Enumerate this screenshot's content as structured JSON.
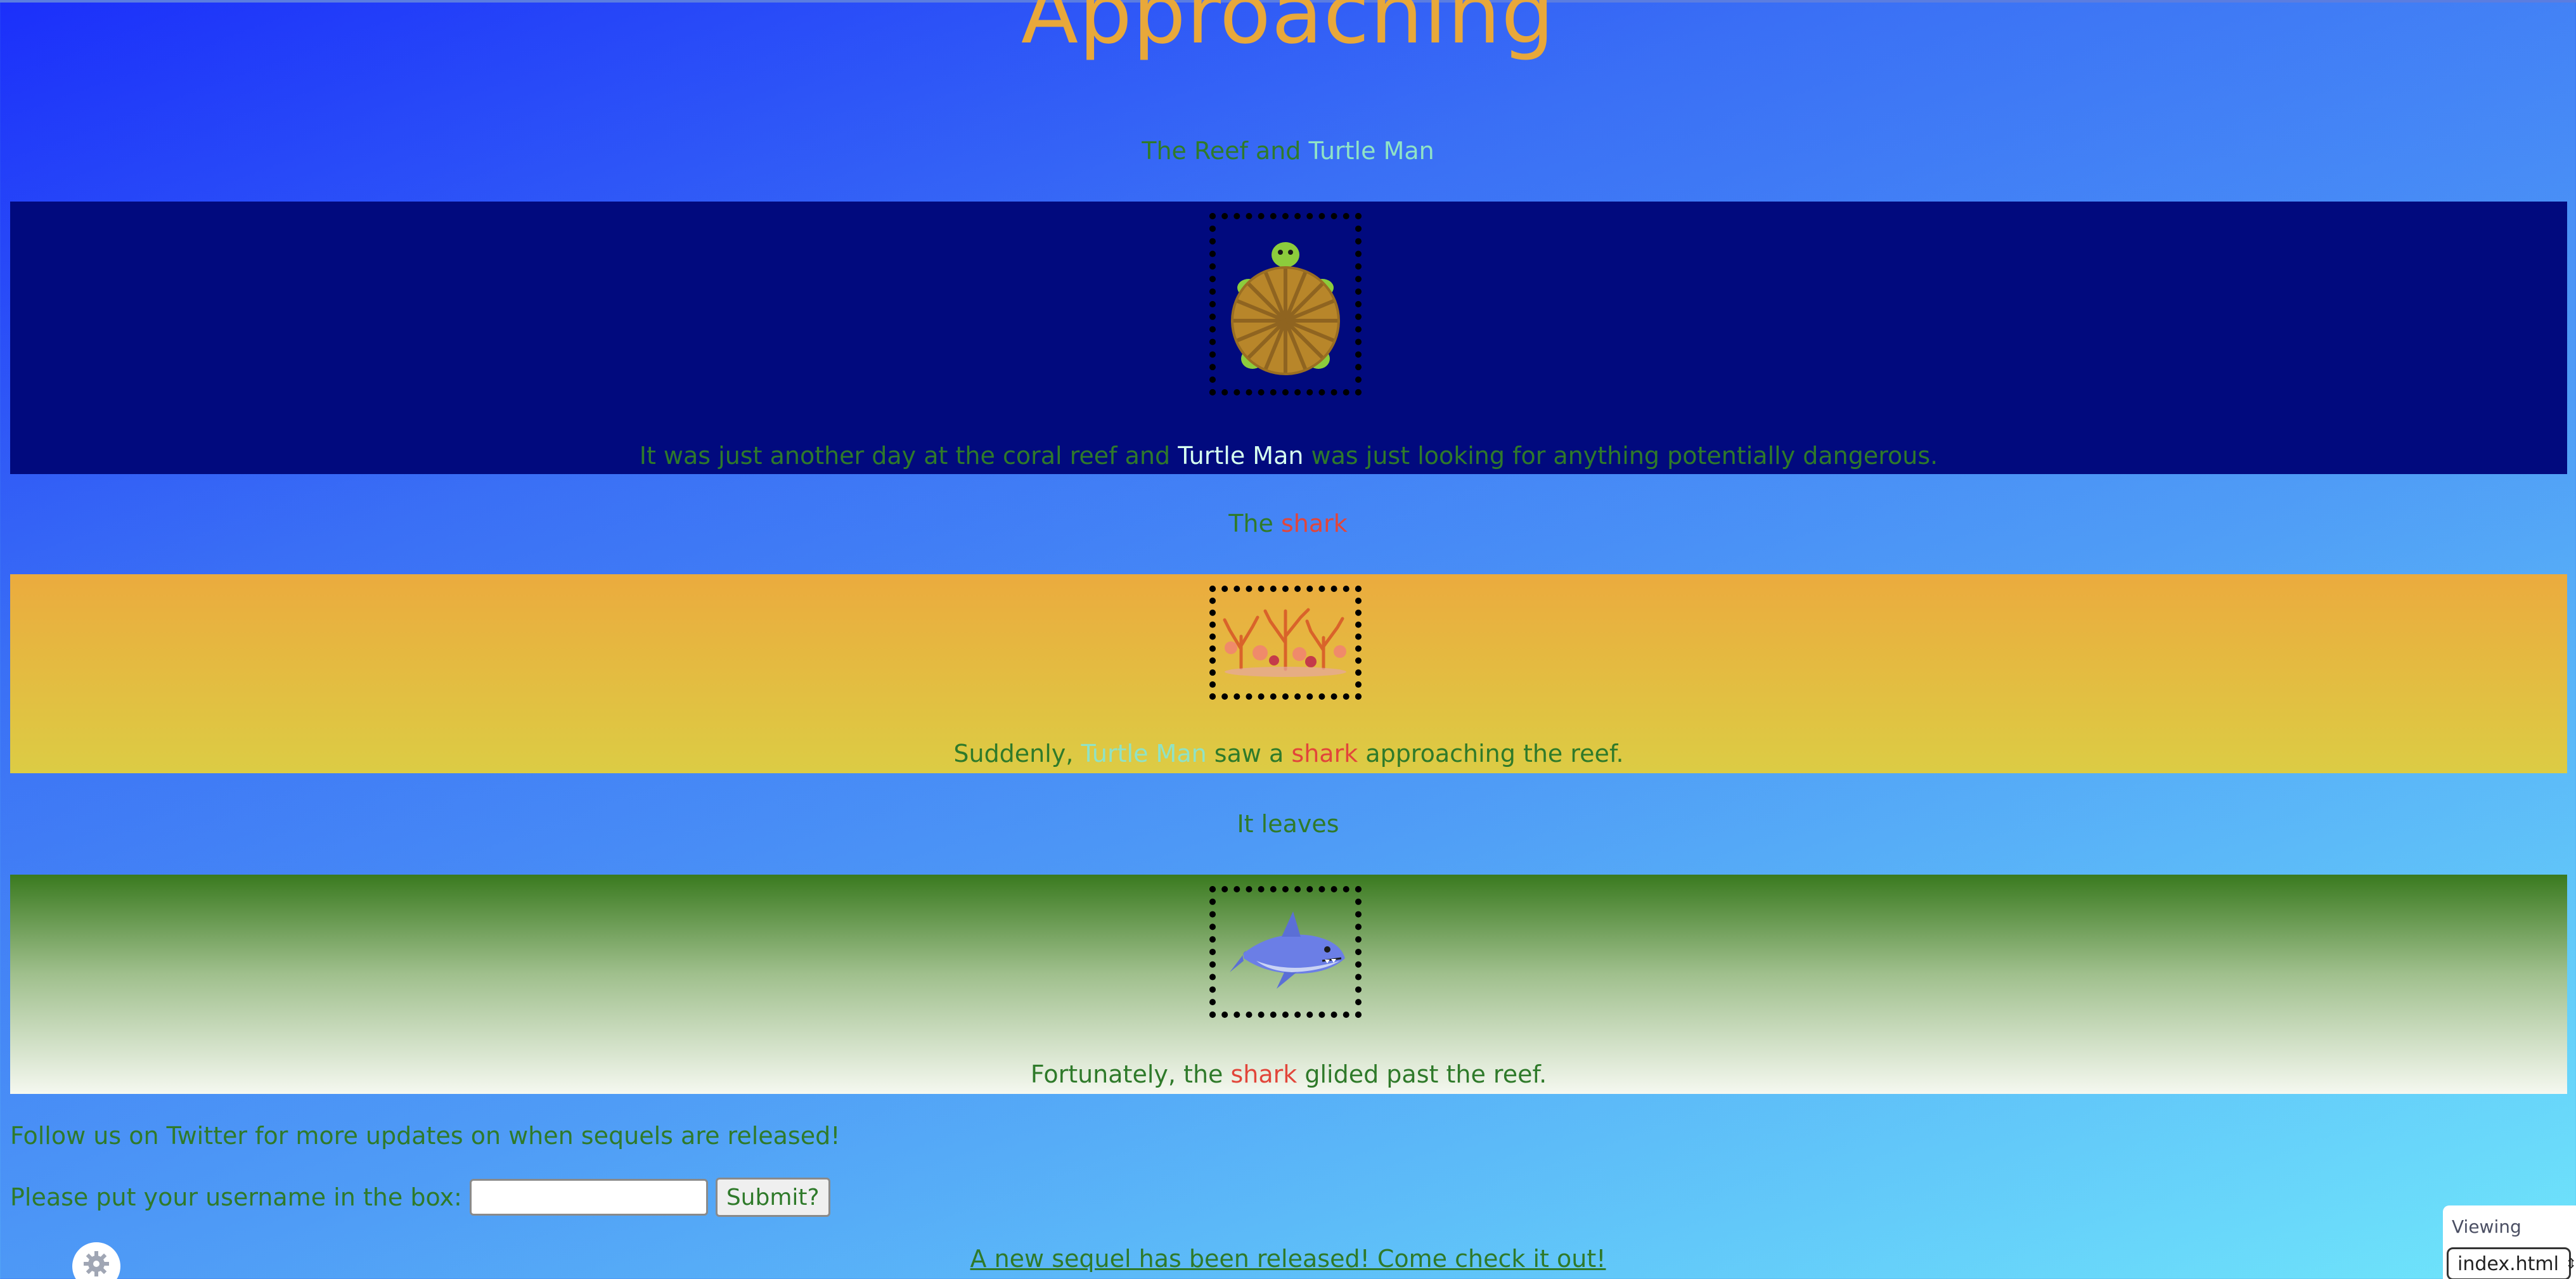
{
  "page": {
    "title": "Approaching"
  },
  "sections": [
    {
      "heading_parts": [
        "The Reef and ",
        "Turtle Man"
      ],
      "image_icon": "turtle-image",
      "caption_parts": [
        "It was just another day at the coral reef and ",
        "Turtle Man",
        " was just looking for anything potentially dangerous."
      ]
    },
    {
      "heading_parts": [
        "The ",
        "shark"
      ],
      "image_icon": "coral-reef-image",
      "caption_parts": [
        "Suddenly, ",
        "Turtle Man",
        " saw a ",
        "shark",
        " approaching the reef."
      ]
    },
    {
      "heading_parts": [
        "It leaves"
      ],
      "image_icon": "shark-image",
      "caption_parts": [
        "Fortunately, the ",
        "shark",
        " glided past the reef."
      ]
    }
  ],
  "footer": {
    "follow_text": "Follow us on Twitter for more updates on when sequels are released!",
    "username_label": "Please put your username in the box:",
    "username_value": "",
    "submit_label": "Submit?",
    "sequel_link": "A new sequel has been released! Come check it out!"
  },
  "viewer": {
    "label": "Viewing",
    "selected_file": "index.html"
  },
  "colors": {
    "title": "#e8a83a",
    "text_green": "#2f7a2a",
    "turtle_name": "#8fe3c6",
    "turtle_name_band": "#d6fff0",
    "shark_name": "#e2453a",
    "band_navy": "#010a7e"
  }
}
